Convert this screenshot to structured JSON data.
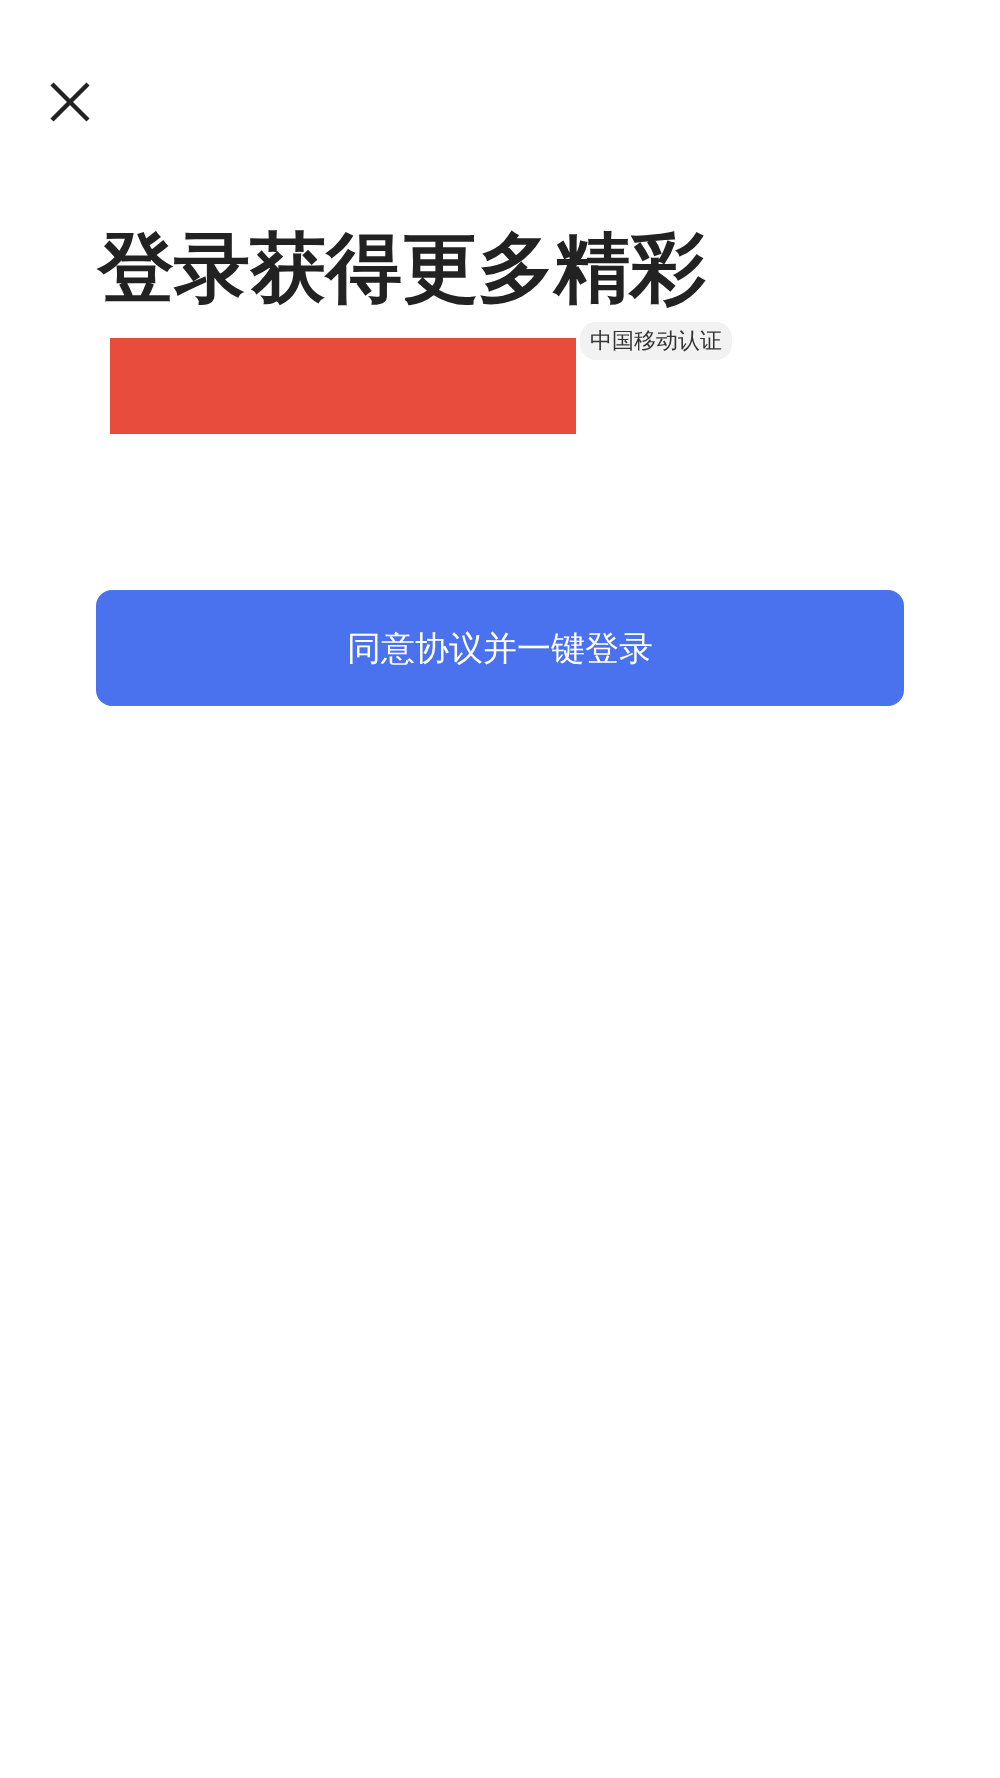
{
  "title": "登录获得更多精彩",
  "phone": {
    "redacted": true,
    "badge": "中国移动认证"
  },
  "login_button": {
    "label": "同意协议并一键登录"
  }
}
